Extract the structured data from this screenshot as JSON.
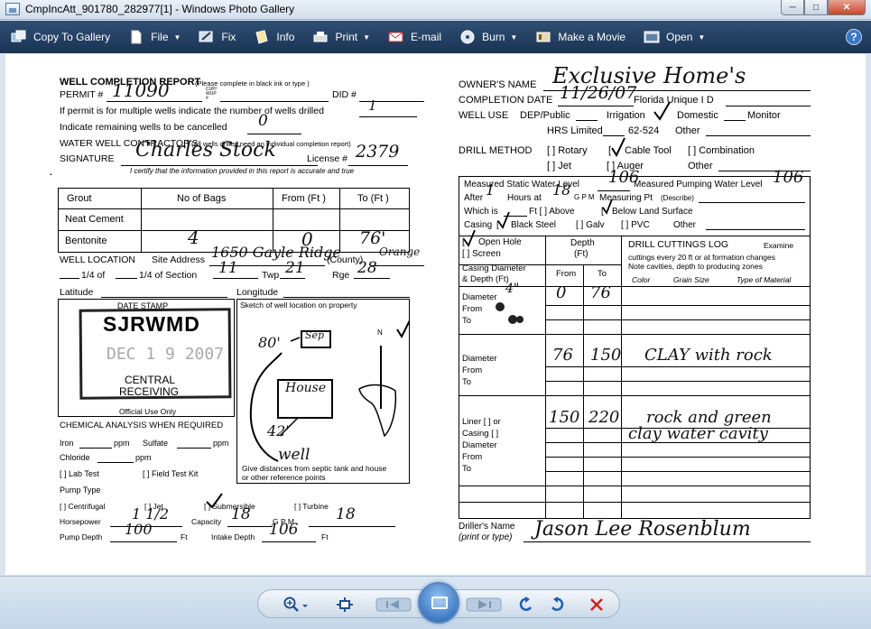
{
  "window": {
    "title": "CmpIncAtt_901780_282977[1] - Windows Photo Gallery"
  },
  "toolbar": {
    "items": [
      {
        "label": "Copy To Gallery",
        "icon": "gallery-icon",
        "dropdown": false
      },
      {
        "label": "File",
        "icon": "file-icon",
        "dropdown": true
      },
      {
        "label": "Fix",
        "icon": "fix-icon",
        "dropdown": false
      },
      {
        "label": "Info",
        "icon": "info-icon",
        "dropdown": false
      },
      {
        "label": "Print",
        "icon": "print-icon",
        "dropdown": true
      },
      {
        "label": "E-mail",
        "icon": "email-icon",
        "dropdown": false
      },
      {
        "label": "Burn",
        "icon": "burn-icon",
        "dropdown": true
      },
      {
        "label": "Make a Movie",
        "icon": "movie-icon",
        "dropdown": false
      },
      {
        "label": "Open",
        "icon": "open-icon",
        "dropdown": true
      }
    ],
    "help": "?"
  },
  "form": {
    "title": "WELL COMPLETION REPORT",
    "title_note": "(Please complete in black ink or type )",
    "permit_label": "PERMIT #",
    "permit_value": "11090",
    "cupwup": "CUP/ WUP #",
    "did_label": "DID #",
    "multi_wells": "If permit is for multiple wells indicate the number of wells drilled",
    "multi_wells_value": "1",
    "cancelled": "Indicate remaining wells to be cancelled",
    "cancelled_value": "0",
    "contractor": "WATER WELL CONTRACTOR'S",
    "contractor_note": "(All wells drilled need an individual completion report)",
    "signature_label": "SIGNATURE",
    "signature_value": "Charles Stock",
    "license_label": "License #",
    "license_value": "2379",
    "certify": "I certify that the information provided in this report is accurate and true",
    "grout_headers": [
      "Grout",
      "No of Bags",
      "From (Ft )",
      "To (Ft )"
    ],
    "grout_rows": [
      {
        "name": "Neat Cement",
        "bags": "",
        "from": "",
        "to": ""
      },
      {
        "name": "Bentonite",
        "bags": "4",
        "from": "0",
        "to": "76'"
      }
    ],
    "well_location": "WELL LOCATION",
    "site_address_label": "Site Address",
    "site_address_value": "1650 Gayle Ridge",
    "county_label": "(County)",
    "county_value": "Orange",
    "quarter_line": "1/4 of",
    "quarter_line2": "1/4 of Section",
    "section_value": "11",
    "twp_label": "Twp",
    "twp_value": "21",
    "rge_label": "Rge",
    "rge_value": "28",
    "latitude": "Latitude",
    "longitude": "Longitude",
    "date_stamp": "DATE STAMP",
    "stamp_agency": "SJRWMD",
    "stamp_date": "DEC 1 9 2007",
    "stamp_central": "CENTRAL",
    "stamp_receiving": "RECEIVING",
    "official_use": "Official Use Only",
    "sketch_label": "Sketch of well location on property",
    "sketch_note1": "Give distances from septic tank and house",
    "sketch_note2": "or other reference points",
    "sketch_marks": {
      "dist1": "80'",
      "sep": "Sep",
      "house": "House",
      "dist2": "42'",
      "well": "well",
      "north": "N"
    },
    "chem_title": "CHEMICAL ANALYSIS WHEN REQUIRED",
    "iron": "Iron",
    "ppm": "ppm",
    "sulfate": "Sulfate",
    "chloride": "Chloride",
    "lab_test": "[ ] Lab Test",
    "field_test": "[ ] Field Test Kit",
    "pump_type": "Pump Type",
    "centrifugal": "[ ] Centrifugal",
    "jet": "[ ] Jet",
    "submersible": "[ ] Submersible",
    "turbine": "[ ] Turbine",
    "horsepower_label": "Horsepower",
    "horsepower_value": "1 1/2",
    "capacity_label": "Capacity",
    "capacity_value": "18",
    "gpm": "G P M",
    "gpm_value": "18",
    "pump_depth_label": "Pump Depth",
    "pump_depth_value": "100",
    "ft": "Ft",
    "intake_label": "Intake Depth",
    "intake_value": "106",
    "owner_label": "OWNER'S NAME",
    "owner_value": "Exclusive Home's",
    "completion_label": "COMPLETION DATE",
    "completion_value": "11/26/07",
    "florida_unique": "Florida Unique I D",
    "well_use": "WELL USE",
    "dep_public": "DEP/Public",
    "irrigation": "Irrigation",
    "domestic": "Domestic",
    "monitor": "Monitor",
    "hrs_limited": "HRS Limited",
    "code": "62-524",
    "other": "Other",
    "drill_method": "DRILL METHOD",
    "rotary": "[ ] Rotary",
    "cable_tool": "Cable Tool",
    "combination": "[ ] Combination",
    "jet2": "[ ] Jet",
    "auger": "[ ] Auger",
    "static_label": "Measured Static Water Level",
    "static_value": "106",
    "pumping_label": "Measured Pumping Water Level",
    "pumping_value": "106",
    "after_label": "After",
    "after_value": "1",
    "hours_label": "Hours at",
    "hours_value": "18",
    "gpm2": "G P M",
    "measuring_pt": "Measuring Pt",
    "describe": "(Describe)",
    "which_is": "Which is",
    "ft_above": "Ft [ ] Above",
    "below_land": "Below Land Surface",
    "casing_label": "Casing",
    "black_steel": "Black Steel",
    "galv": "[ ] Galv",
    "pvc": "[ ] PVC",
    "open_hole": "Open Hole",
    "screen": "[ ] Screen",
    "depth_label": "Depth",
    "depth_ft": "(Ft)",
    "drill_log_title": "DRILL CUTTINGS LOG",
    "examine": "Examine",
    "log_note1": "cuttings every 20 ft or at formation changes",
    "log_note2": "Note cavities, depth to producing zones",
    "log_cols": [
      "Color",
      "Grain Size",
      "Type of Material"
    ],
    "casing_diam": "Casing Diameter",
    "depth_ft2": "& Depth (Ft)",
    "from": "From",
    "to": "To",
    "diameter": "Diameter",
    "diameter1_value": "4\"",
    "liner": "Liner [ ] or",
    "casing2": "Casing [ ]",
    "log_rows": [
      {
        "from": "0",
        "to": "76",
        "desc": ""
      },
      {
        "from": "76",
        "to": "150",
        "desc": "CLAY with rock"
      },
      {
        "from": "150",
        "to": "220",
        "desc": "rock and green"
      },
      {
        "from": "",
        "to": "",
        "desc": "clay  water cavity"
      }
    ],
    "driller_label": "Driller's Name",
    "driller_note": "(print or type)",
    "driller_value": "Jason Lee Rosenblum"
  },
  "bottombar": {
    "zoom": "zoom-icon",
    "fit": "actual-size-icon",
    "prev": "previous-icon",
    "play": "slideshow-icon",
    "next": "next-icon",
    "rotate_ccw": "rotate-counterclockwise-icon",
    "rotate_cw": "rotate-clockwise-icon",
    "delete": "delete-icon"
  }
}
